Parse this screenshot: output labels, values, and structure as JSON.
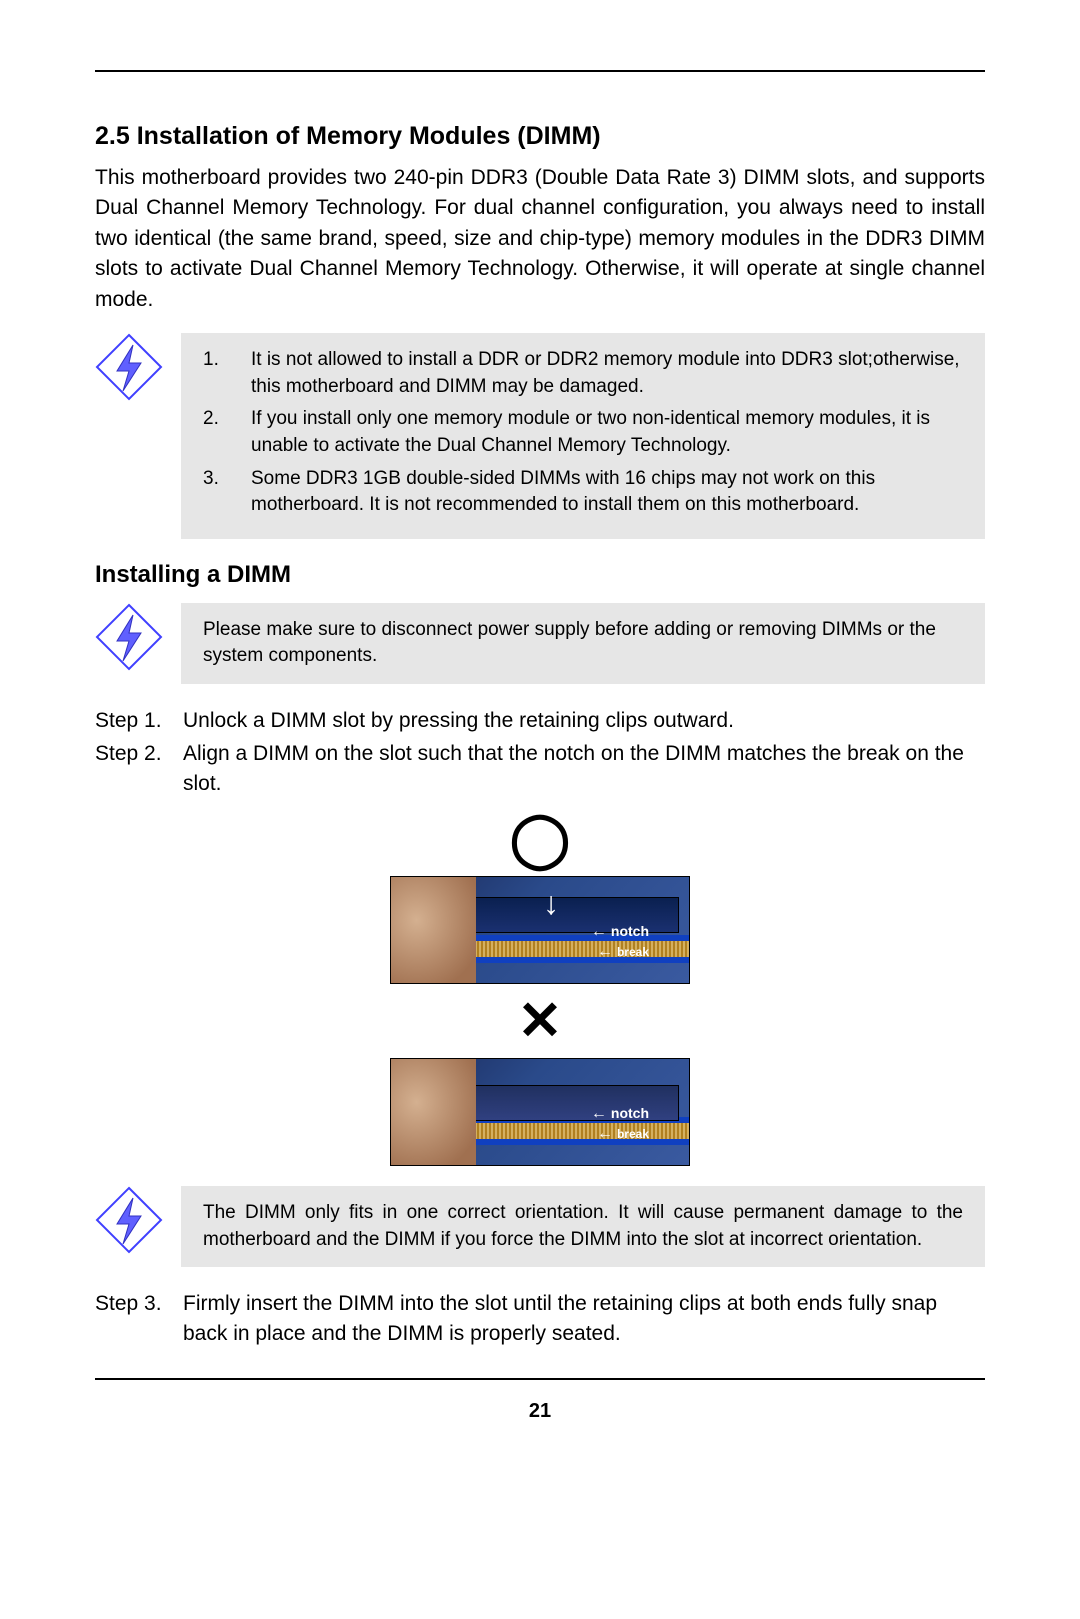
{
  "section": {
    "heading": "2.5  Installation of Memory Modules (DIMM)",
    "intro": "This motherboard provides two 240-pin DDR3 (Double Data Rate 3) DIMM slots, and supports Dual Channel Memory Technology. For dual channel configuration, you always need to install two identical (the same brand, speed, size and chip-type) memory modules in the DDR3 DIMM slots to activate Dual Channel Memory Technology. Otherwise, it will operate at single channel mode."
  },
  "note1": {
    "items": [
      {
        "num": "1.",
        "text": "It is not allowed to install a DDR or DDR2 memory module into DDR3 slot;otherwise, this motherboard and DIMM may be damaged."
      },
      {
        "num": "2.",
        "text": "If you install only one memory module or two non-identical memory modules, it is unable to activate the Dual Channel Memory Technology."
      },
      {
        "num": "3.",
        "text": "Some DDR3 1GB double-sided DIMMs with 16 chips may not work on this motherboard. It is not recommended to install them on this motherboard."
      }
    ]
  },
  "subheading": "Installing a DIMM",
  "note2": {
    "text": "Please make sure to disconnect power supply before adding or removing DIMMs or the system components."
  },
  "steps_a": [
    {
      "label": "Step 1.",
      "text": "Unlock a DIMM slot by pressing the retaining clips outward."
    },
    {
      "label": "Step 2.",
      "text": "Align a DIMM on the slot such that the notch on the DIMM matches the break on the slot."
    }
  ],
  "figure": {
    "correct_symbol": "◯",
    "incorrect_symbol": "✕",
    "labels": {
      "notch": "notch",
      "break": "break",
      "arrow_down": "↓",
      "arrow_left": "←"
    }
  },
  "note3": {
    "text": "The DIMM only fits in one correct orientation. It will cause permanent damage to the motherboard and the DIMM if you force the DIMM into the slot at incorrect orientation."
  },
  "steps_b": [
    {
      "label": "Step 3.",
      "text": "Firmly insert the DIMM into the slot until the retaining clips at both ends fully snap back in place and the DIMM is properly seated."
    }
  ],
  "page_number": "21"
}
